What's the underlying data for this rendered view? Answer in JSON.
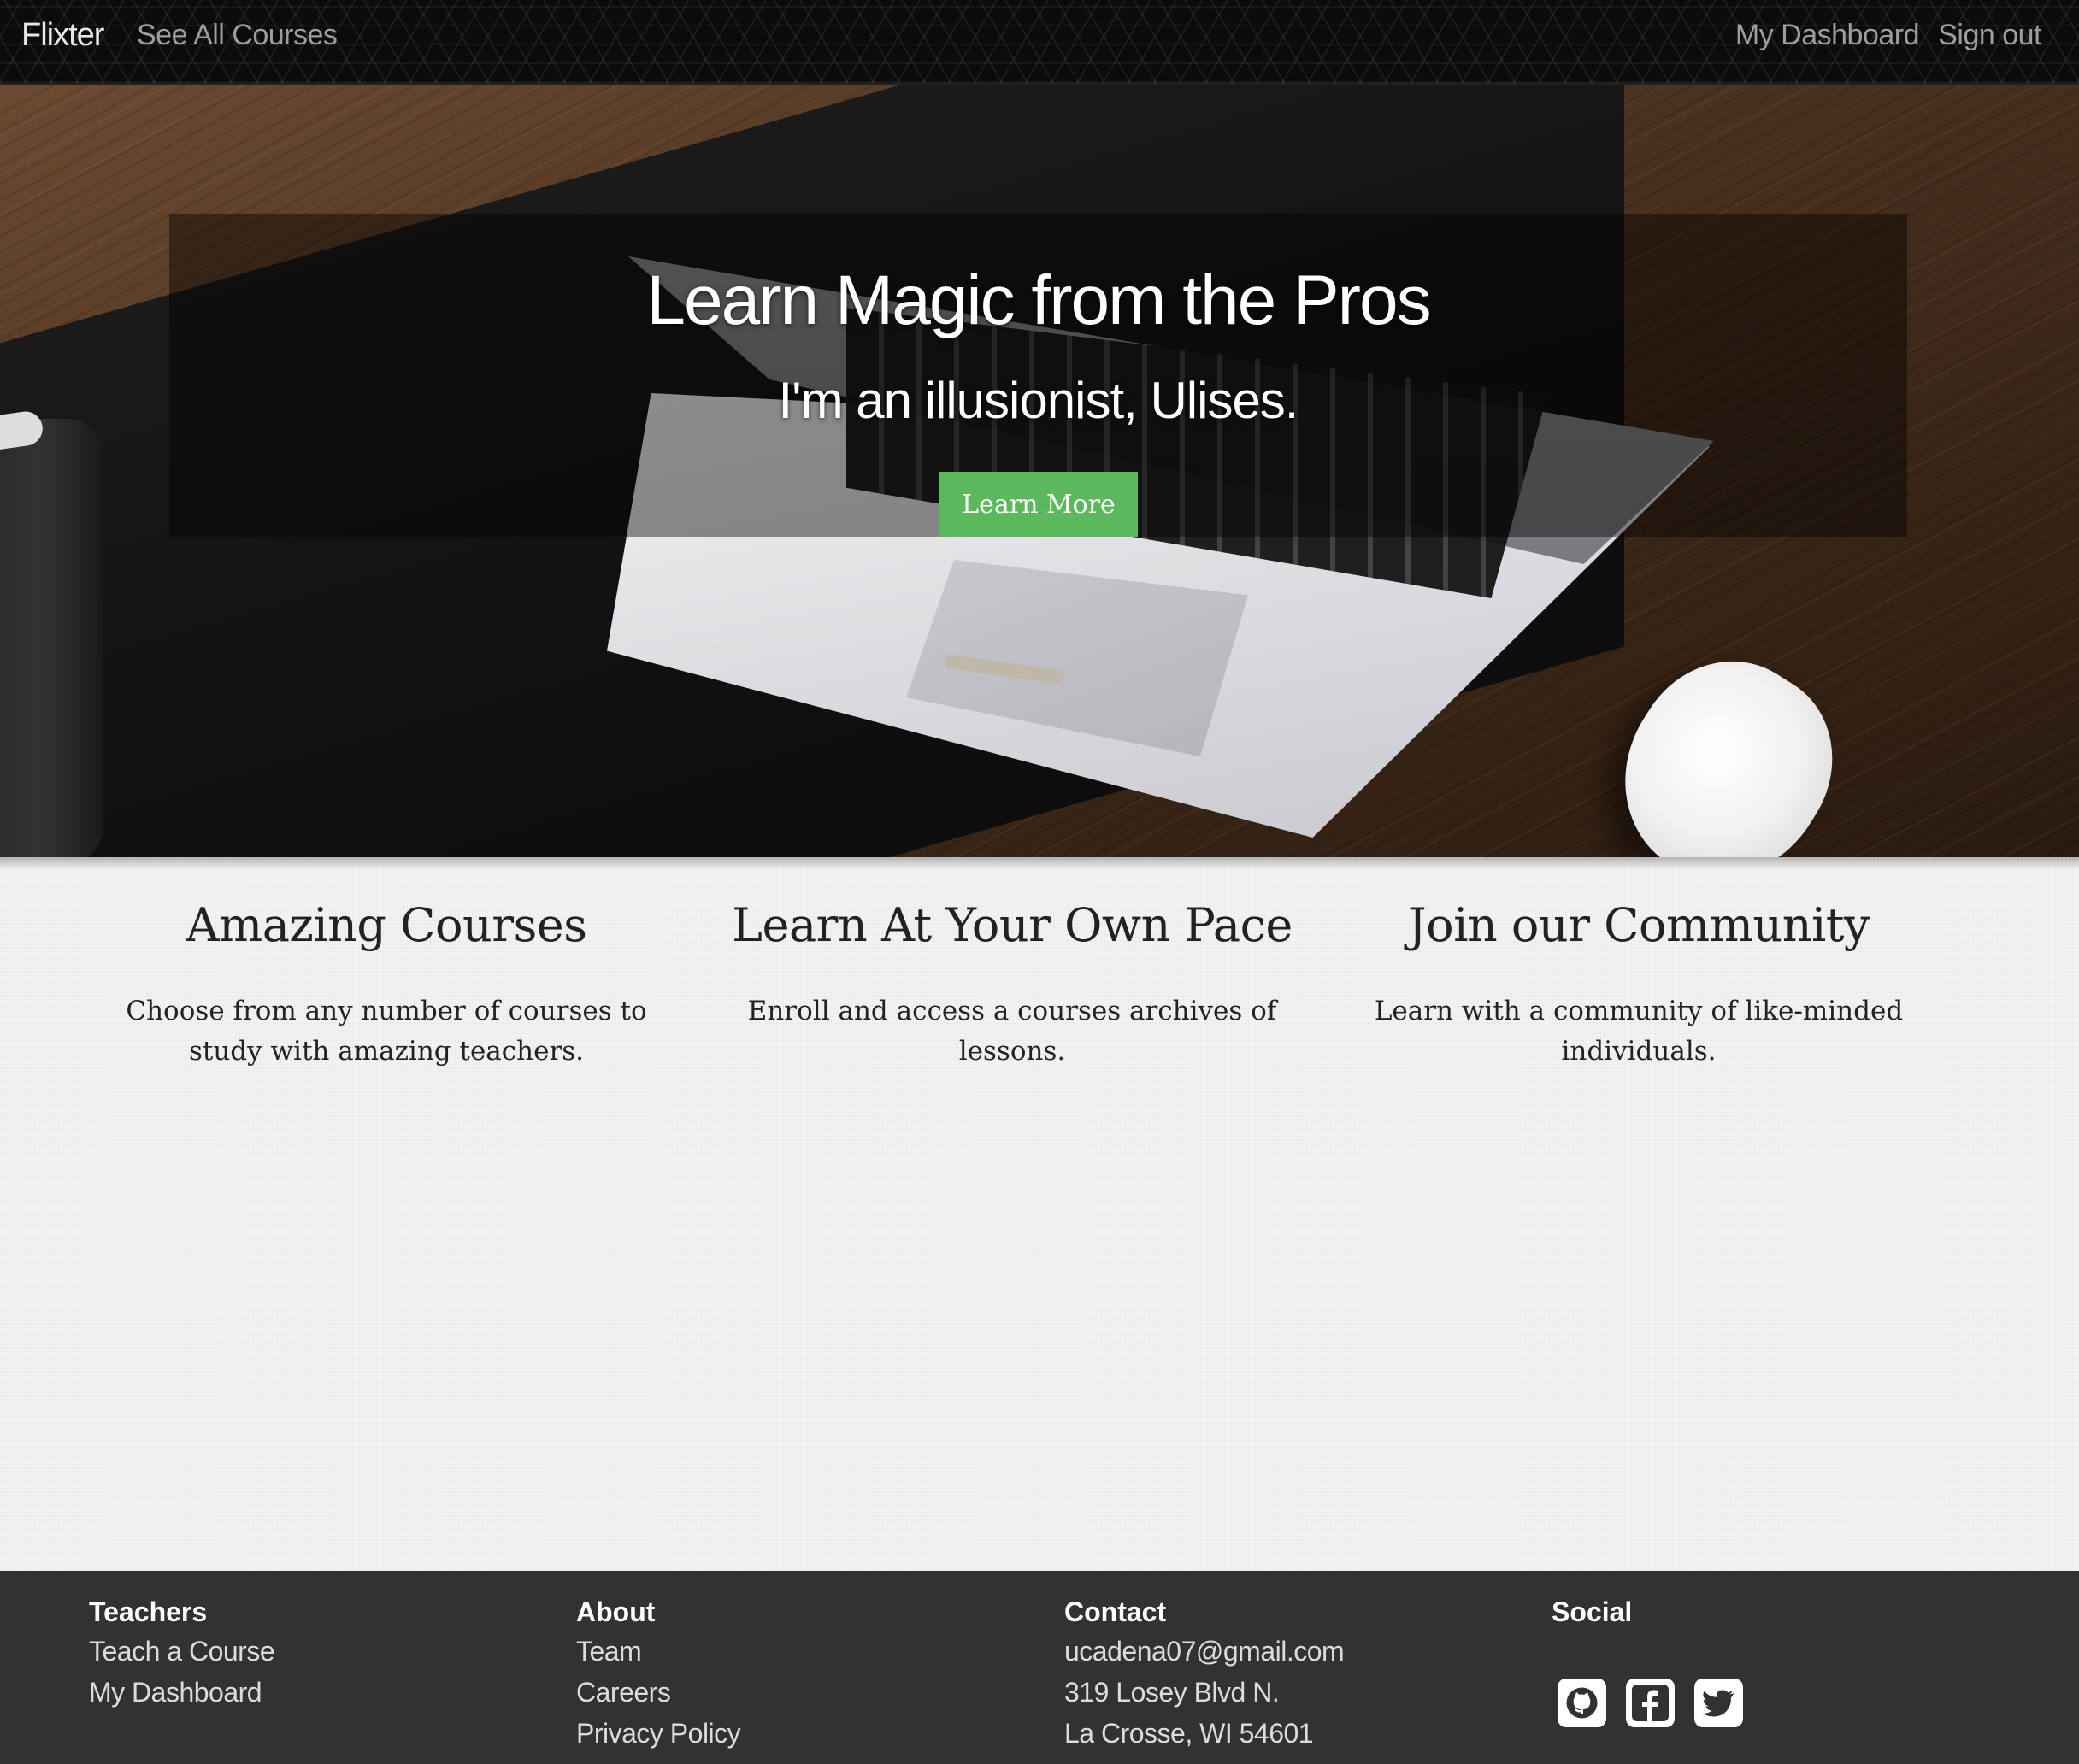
{
  "navbar": {
    "brand": "Flixter",
    "see_all": "See All Courses",
    "dashboard": "My Dashboard",
    "signout": "Sign out"
  },
  "hero": {
    "title": "Learn Magic from the Pros",
    "subtitle": "I'm an illusionist, Ulises.",
    "button": "Learn More",
    "button_color": "#5cb85c"
  },
  "features": [
    {
      "title": "Amazing Courses",
      "text": "Choose from any number of courses to study with amazing teachers."
    },
    {
      "title": "Learn At Your Own Pace",
      "text": "Enroll and access a courses archives of lessons."
    },
    {
      "title": "Join our Community",
      "text": "Learn with a community of like-minded individuals."
    }
  ],
  "footer": {
    "teachers": {
      "heading": "Teachers",
      "links": [
        "Teach a Course",
        "My Dashboard"
      ]
    },
    "about": {
      "heading": "About",
      "links": [
        "Team",
        "Careers",
        "Privacy Policy"
      ]
    },
    "contact": {
      "heading": "Contact",
      "email": "ucadena07@gmail.com",
      "address1": "319 Losey Blvd N.",
      "address2": "La Crosse, WI 54601"
    },
    "social": {
      "heading": "Social",
      "icons": [
        "github-icon",
        "facebook-icon",
        "twitter-icon"
      ]
    }
  }
}
